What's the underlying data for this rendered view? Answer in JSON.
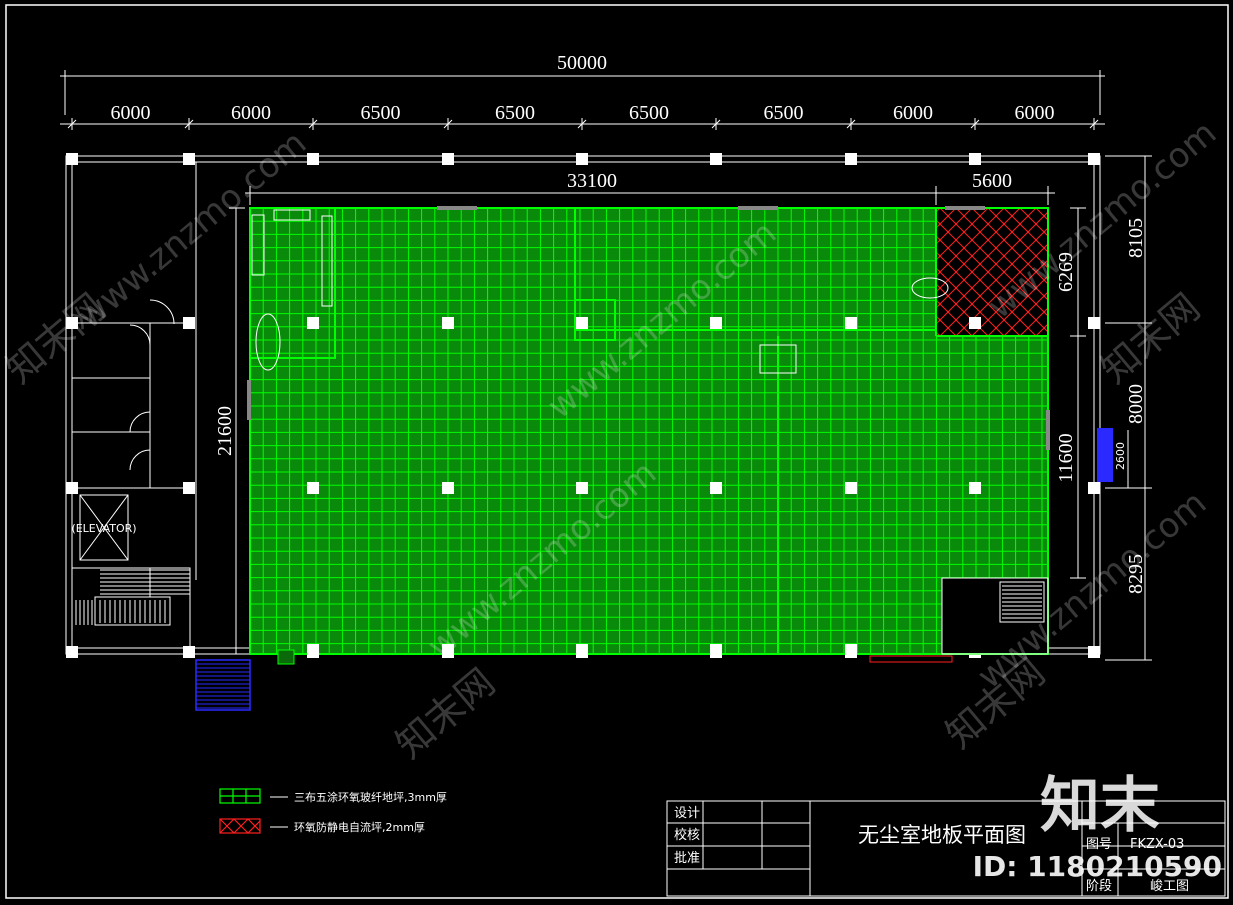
{
  "drawing": {
    "title": "无尘室地板平面图",
    "top_total": "50000",
    "top_spans": [
      "6000",
      "6000",
      "6500",
      "6500",
      "6500",
      "6500",
      "6000",
      "6000"
    ],
    "inner_width": "33100",
    "inner_right": "5600",
    "left_height": "21600",
    "inner_height": "11600",
    "inner_top_right": "6269",
    "right_spans": [
      "8105",
      "8000",
      "8295"
    ],
    "door_width": "2600",
    "elevator_label": "(ELEVATOR)"
  },
  "legend": [
    {
      "label": "三布五涂环氧玻纤地坪,3mm厚",
      "swatch": "green-grid"
    },
    {
      "label": "环氧防静电自流坪,2mm厚",
      "swatch": "red-cross"
    }
  ],
  "title_block": {
    "design": "设计",
    "check": "校核",
    "approve": "批准",
    "drawing_no_label": "图号",
    "drawing_no": "FKZX-03",
    "stage_label": "阶段",
    "stage": "峻工图"
  },
  "watermark": {
    "brand": "知末",
    "id": "ID: 1180210590",
    "site": "www.znzmo.com",
    "site_cn": "知末网"
  },
  "colors": {
    "background": "#000000",
    "floor_grid": "#00ff00",
    "floor_fill": "#0a8a0a",
    "antistatic": "#ff2020",
    "lines": "#ffffff",
    "door": "#2a2aff"
  }
}
